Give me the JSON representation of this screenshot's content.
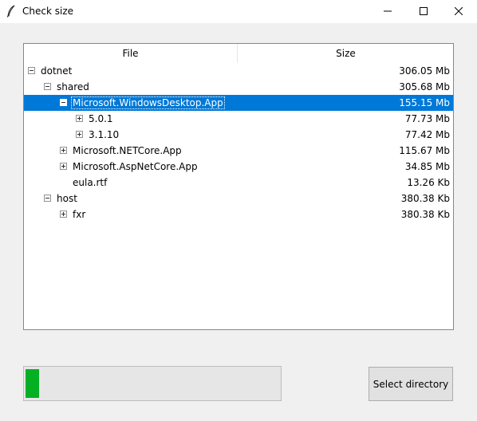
{
  "window": {
    "title": "Check size",
    "icon": "feather-icon"
  },
  "tree": {
    "columns": {
      "file": "File",
      "size": "Size"
    },
    "rows": [
      {
        "name": "dotnet",
        "size": "306.05 Mb",
        "state": "expanded",
        "depth": 0
      },
      {
        "name": "shared",
        "size": "305.68 Mb",
        "state": "expanded",
        "depth": 1
      },
      {
        "name": "Microsoft.WindowsDesktop.App",
        "size": "155.15 Mb",
        "state": "expanded",
        "depth": 2,
        "selected": true
      },
      {
        "name": "5.0.1",
        "size": "77.73 Mb",
        "state": "collapsed",
        "depth": 3
      },
      {
        "name": "3.1.10",
        "size": "77.42 Mb",
        "state": "collapsed",
        "depth": 3
      },
      {
        "name": "Microsoft.NETCore.App",
        "size": "115.67 Mb",
        "state": "collapsed",
        "depth": 2
      },
      {
        "name": "Microsoft.AspNetCore.App",
        "size": "34.85 Mb",
        "state": "collapsed",
        "depth": 2
      },
      {
        "name": "eula.rtf",
        "size": "13.26 Kb",
        "state": "leaf",
        "depth": 2
      },
      {
        "name": "host",
        "size": "380.38 Kb",
        "state": "expanded",
        "depth": 1
      },
      {
        "name": "fxr",
        "size": "380.38 Kb",
        "state": "collapsed",
        "depth": 2
      }
    ]
  },
  "progress": {
    "value": 0.053,
    "color": "#06b025"
  },
  "buttons": {
    "select_directory": "Select directory"
  },
  "colors": {
    "selection": "#0078d7"
  }
}
